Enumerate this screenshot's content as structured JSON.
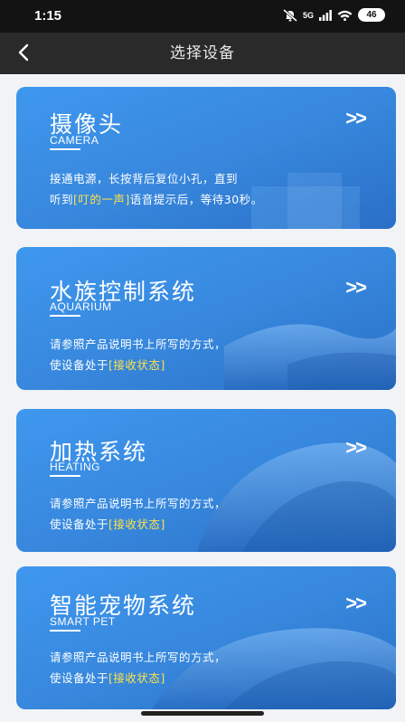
{
  "status_bar": {
    "time": "1:15",
    "network": "5G",
    "battery": "46"
  },
  "nav": {
    "title": "选择设备"
  },
  "icons": {
    "back": "back-arrow-icon",
    "arrow": "double-chevron-right-icon"
  },
  "colors": {
    "card_blue": "#3a8be0",
    "highlight": "#ffe24a",
    "nav_bg": "#2a2a2a"
  },
  "cards": [
    {
      "title": "摄像头",
      "subtitle": "CAMERA",
      "arrow": ">>",
      "line1": "接通电源，长按背后复位小孔，直到",
      "line2_pre": "听到",
      "line2_highlight": "[叮的一声]",
      "line2_post": "语音提示后，等待30秒。"
    },
    {
      "title": "水族控制系统",
      "subtitle": "AQUARIUM",
      "arrow": ">>",
      "line1": "请参照产品说明书上所写的方式，",
      "line2_pre": "使设备处于",
      "line2_highlight": "[接收状态]",
      "line2_post": ""
    },
    {
      "title": "加热系统",
      "subtitle": "HEATING",
      "arrow": ">>",
      "line1": "请参照产品说明书上所写的方式，",
      "line2_pre": "使设备处于",
      "line2_highlight": "[接收状态]",
      "line2_post": ""
    },
    {
      "title": "智能宠物系统",
      "subtitle": "SMART PET",
      "arrow": ">>",
      "line1": "请参照产品说明书上所写的方式，",
      "line2_pre": "使设备处于",
      "line2_highlight": "[接收状态]",
      "line2_post": ""
    }
  ]
}
